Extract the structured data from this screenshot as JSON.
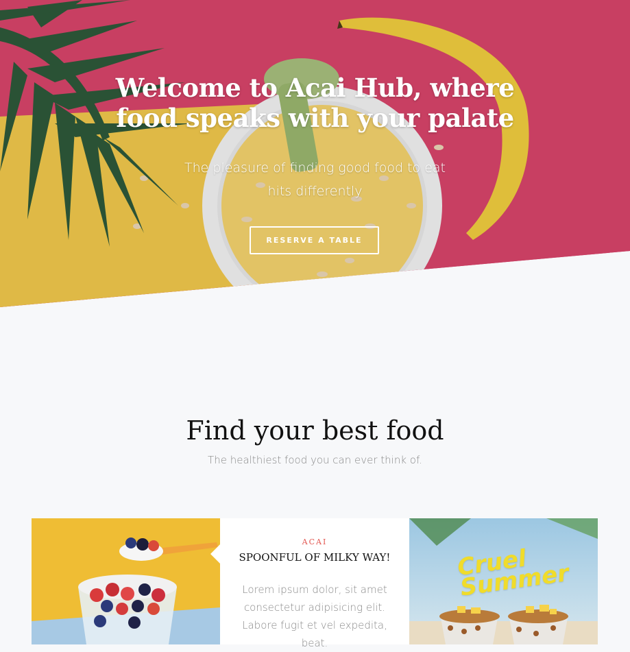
{
  "hero": {
    "title": "Welcome to Acai Hub, where food speaks with your palate",
    "subtitle": "The pleasure of finding good food to eat hits differently",
    "cta_label": "RESERVE A TABLE",
    "colors": {
      "background": "#d9456b",
      "yellow": "#f2c94c",
      "leaf": "#2e5a3a"
    }
  },
  "section": {
    "title": "Find your best food",
    "subtitle": "The healthiest food you can ever think of."
  },
  "cards": {
    "featured": {
      "tag": "ACAI",
      "title": "SPOONFUL OF MILKY WAY!",
      "text": "Lorem ipsum dolor, sit amet consectetur adipisicing elit. Labore fugit et vel expedita, beat."
    },
    "right_image_caption": "Cruel Summer"
  },
  "colors": {
    "accent": "#e2554f",
    "page_bg": "#f7f8fa"
  }
}
